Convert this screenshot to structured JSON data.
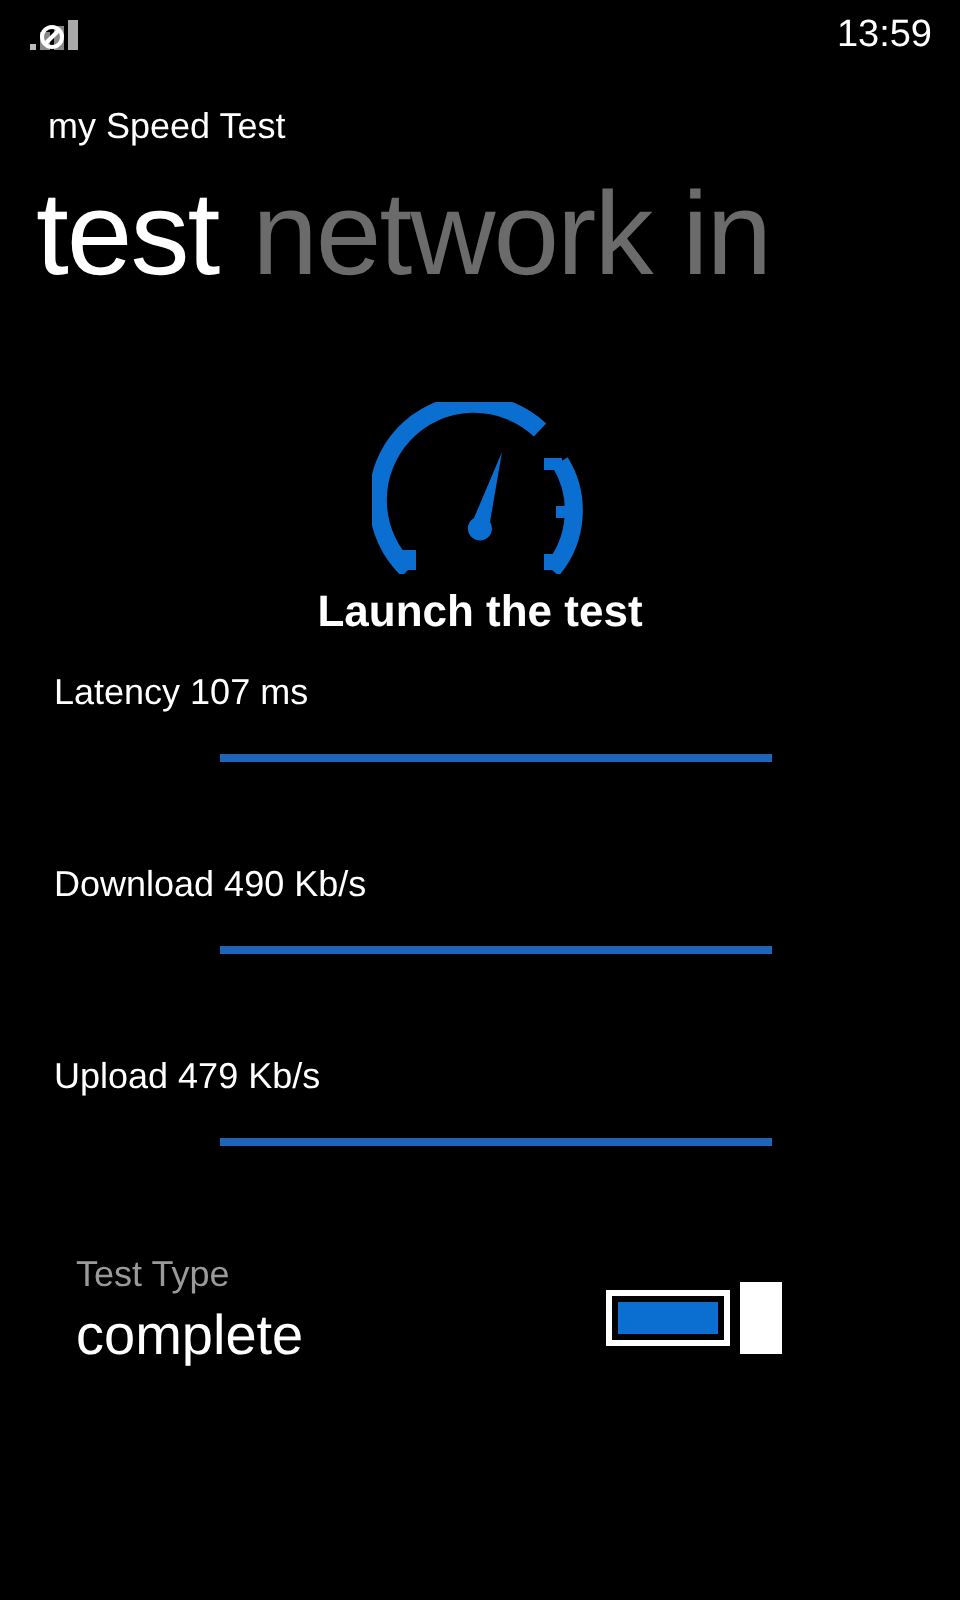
{
  "status_bar": {
    "time": "13:59"
  },
  "app_title": "my Speed Test",
  "pivot": [
    {
      "label": "test",
      "selected": true
    },
    {
      "label": "network in",
      "selected": false
    }
  ],
  "launch": {
    "label": "Launch the test"
  },
  "metrics": [
    {
      "label": "Latency 107 ms",
      "level": 1
    },
    {
      "label": "Download 490 Kb/s",
      "level": 1
    },
    {
      "label": "Upload 479 Kb/s",
      "level": 1
    }
  ],
  "test_type": {
    "label": "Test Type",
    "value": "complete",
    "on": true
  }
}
